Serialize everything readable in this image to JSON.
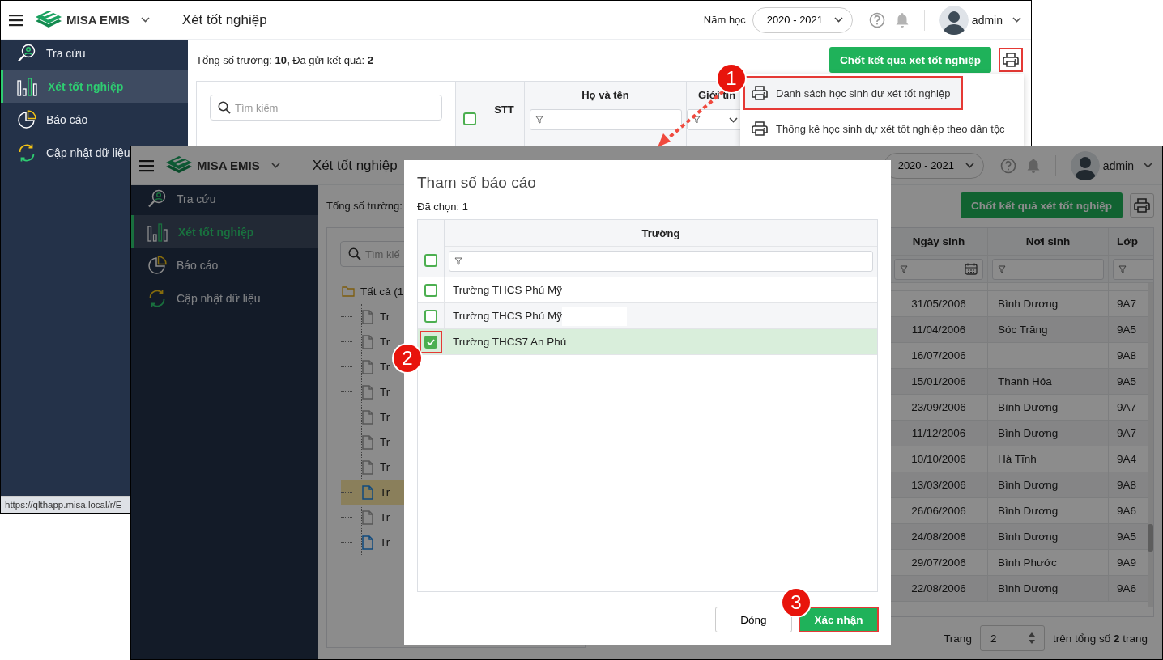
{
  "back_window": {
    "app_name": "MISA EMIS",
    "page_title": "Xét tốt nghiệp",
    "year_label": "Năm học",
    "year_value": "2020 - 2021",
    "user": "admin",
    "sidebar": [
      {
        "label": "Tra cứu",
        "kind": "lookup",
        "selected": false
      },
      {
        "label": "Xét tốt nghiệp",
        "kind": "bars",
        "selected": true
      },
      {
        "label": "Báo cáo",
        "kind": "pie",
        "selected": false
      },
      {
        "label": "Cập nhật dữ liệu",
        "kind": "sync",
        "selected": false
      }
    ],
    "summary": "Tổng số trường: **10,** Đã gửi kết quả: **2**",
    "primary_button": "Chốt kết quả xét tốt nghiệp",
    "print_annotated": true,
    "search": {
      "placeholder": "Tìm kiếm"
    },
    "table": {
      "header_checked": false,
      "columns": [
        "STT",
        "Họ và tên",
        "Giới tín"
      ]
    },
    "print_menu": [
      {
        "label": "Danh sách học sinh dự xét tốt nghiệp",
        "annotated": true
      },
      {
        "label": "Thống kê học sinh dự xét tốt nghiệp theo dân tộc",
        "annotated": false
      }
    ],
    "status_url": "https://qlthapp.misa.local/r/E"
  },
  "front_window": {
    "app_name": "MISA EMIS",
    "page_title": "Xét tốt nghiệp",
    "year_value": "2020 - 2021",
    "user": "admin",
    "sidebar": [
      {
        "label": "Tra cứu",
        "kind": "lookup",
        "selected": false
      },
      {
        "label": "Xét tốt nghiệp",
        "kind": "bars",
        "selected": true
      },
      {
        "label": "Báo cáo",
        "kind": "pie",
        "selected": false
      },
      {
        "label": "Cập nhật dữ liệu",
        "kind": "sync",
        "selected": false
      }
    ],
    "summary": "Tổng số trường:",
    "primary_button": "Chốt kết quả xét tốt nghiệp",
    "print_annotated": false,
    "search": {
      "placeholder": "Tìm kiế"
    },
    "tree": {
      "label": "Tất cả (1",
      "children": [
        {
          "label": "Tr",
          "active": false,
          "selected": false
        },
        {
          "label": "Tr",
          "active": false,
          "selected": false
        },
        {
          "label": "Tr",
          "active": false,
          "selected": false
        },
        {
          "label": "Tr",
          "active": false,
          "selected": false
        },
        {
          "label": "Tr",
          "active": false,
          "selected": false
        },
        {
          "label": "Tr",
          "active": false,
          "selected": false
        },
        {
          "label": "Tr",
          "active": false,
          "selected": false
        },
        {
          "label": "Tr",
          "active": true,
          "selected": true
        },
        {
          "label": "Tr",
          "active": false,
          "selected": false
        },
        {
          "label": "Tr",
          "active": true,
          "selected": false
        }
      ]
    },
    "table": {
      "columns": [
        "Ngày sinh",
        "Nơi sinh",
        "Lớp"
      ],
      "rows": [
        [
          "31/05/2006",
          "Bình Dương",
          "9A7"
        ],
        [
          "11/04/2006",
          "Sóc Trăng",
          "9A5"
        ],
        [
          "16/07/2006",
          "",
          "9A8"
        ],
        [
          "15/01/2006",
          "Thanh Hóa",
          "9A5"
        ],
        [
          "23/09/2006",
          "Bình Dương",
          "9A7"
        ],
        [
          "11/12/2006",
          "Bình Dương",
          "9A7"
        ],
        [
          "10/10/2006",
          "Hà Tĩnh",
          "9A4"
        ],
        [
          "13/03/2006",
          "Bình Dương",
          "9A8"
        ],
        [
          "26/06/2006",
          "Bình Dương",
          "9A6"
        ],
        [
          "24/08/2006",
          "Bình Dương",
          "9A5"
        ],
        [
          "29/07/2006",
          "Bình Phước",
          "9A9"
        ],
        [
          "22/08/2006",
          "Bình Dương",
          "9A6"
        ]
      ]
    },
    "pagination": {
      "label": "Trang",
      "page": "2",
      "total": "trên tổng số **2** trang"
    }
  },
  "dialog": {
    "title": "Tham số báo cáo",
    "selected_count": "Đã chọn: 1",
    "column": "Trường",
    "header_checked": false,
    "rows": [
      {
        "name": "Trường THCS Phú Mỹ",
        "checked": false,
        "redacted": false,
        "annotated": false
      },
      {
        "name": "Trường THCS Phú Mỹ",
        "checked": false,
        "redacted": true,
        "annotated": false
      },
      {
        "name": "Trường THCS7 An Phú",
        "checked": true,
        "redacted": false,
        "annotated": true
      }
    ],
    "buttons": [
      {
        "label": "Đóng",
        "kind": "secondary",
        "annotated": false
      },
      {
        "label": "Xác nhận",
        "kind": "primary",
        "annotated": true
      }
    ]
  },
  "callouts": [
    {
      "label": "1"
    },
    {
      "label": "2"
    },
    {
      "label": "3"
    }
  ]
}
